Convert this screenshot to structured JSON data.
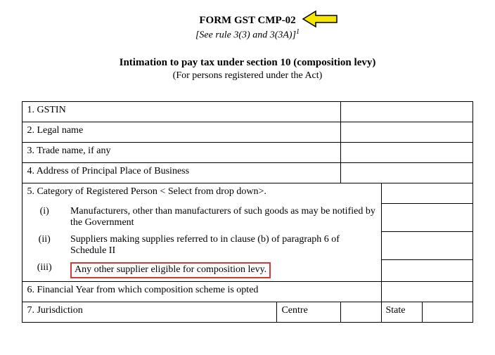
{
  "header": {
    "form_title": "FORM GST CMP-02",
    "rule_ref": "[See rule 3(3) and 3(3A)]",
    "footnote_mark": "1",
    "intimation_title": "Intimation to pay tax under section 10 (composition levy)",
    "subtitle": "(For persons registered under the Act)"
  },
  "rows": {
    "r1": "1.  GSTIN",
    "r2": "2.  Legal name",
    "r3": "3.  Trade name, if any",
    "r4": "4.  Address of Principal Place of Business",
    "r5": "5.  Category of Registered Person  < Select from drop down>.",
    "r5_i_num": "(i)",
    "r5_i": "Manufacturers, other than manufacturers of such goods as may be notified by the Government",
    "r5_ii_num": "(ii)",
    "r5_ii": "Suppliers making supplies referred to in   clause (b) of paragraph 6 of Schedule II",
    "r5_iii_num": "(iii)",
    "r5_iii": "Any other supplier eligible for composition levy.",
    "r6": "6. Financial Year from which composition scheme is opted",
    "r7": "7. Jurisdiction",
    "r7_centre": "Centre",
    "r7_state": "State"
  }
}
